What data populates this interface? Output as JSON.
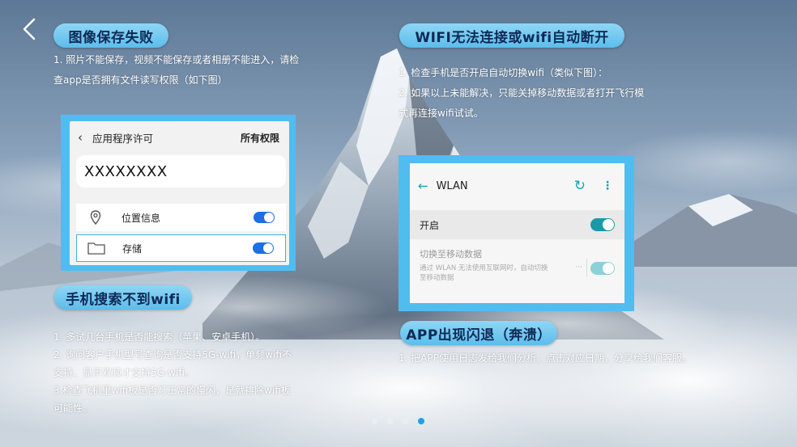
{
  "sections": {
    "save_fail": {
      "title": "图像保存失败",
      "lines": [
        "1. 照片不能保存，视频不能保存或者相册不能进入，请检",
        "查app是否拥有文件读写权限（如下图）"
      ]
    },
    "wifi_disconnect": {
      "title": "WIFI无法连接或wifi自动断开",
      "lines": [
        "1. 检查手机是否开启自动切换wifi（类似下图）：",
        "2. 如果以上未能解决，只能关掉移动数据或者打开飞行模",
        "式再连接wifi试试。"
      ]
    },
    "phone_search": {
      "title": "手机搜索不到wifi",
      "lines": [
        "1. 多试几台手机是否能搜索（苹果、安卓手机）。",
        "2. 询问客户手机型号查询是否支持5G-wifi，单频wifi不",
        "支持、显示双频才支持5G-wifi。",
        "3.检查飞机里wifi板是否灯正常的慢闪，是就排除wifi板",
        "可能性。"
      ]
    },
    "app_crash": {
      "title": "APP出现闪退（奔溃）",
      "lines": [
        "1. 把APP使用日志发给我们分析，点击对应日期，分享给我们客服。"
      ]
    }
  },
  "card_permissions": {
    "header": "应用程序许可",
    "header_right": "所有权限",
    "app_name": "XXXXXXXX",
    "rows": [
      {
        "label": "位置信息",
        "icon": "location-pin-icon",
        "on": true
      },
      {
        "label": "存储",
        "icon": "folder-icon",
        "on": true
      }
    ]
  },
  "card_wlan": {
    "title": "WLAN",
    "on_label": "开启",
    "switch_label": "切换至移动数据",
    "switch_desc_1": "通过 WLAN 无法使用互联网时，自动切换",
    "switch_desc_2": "至移动数据",
    "more_dots": "···"
  },
  "pagination": {
    "count": 4,
    "active": 4
  },
  "colors": {
    "accent": "#1aa3ea",
    "pill": "#6cc6f0",
    "card_border": "#4fbdf0",
    "wlan_teal": "#1a9aa8"
  }
}
